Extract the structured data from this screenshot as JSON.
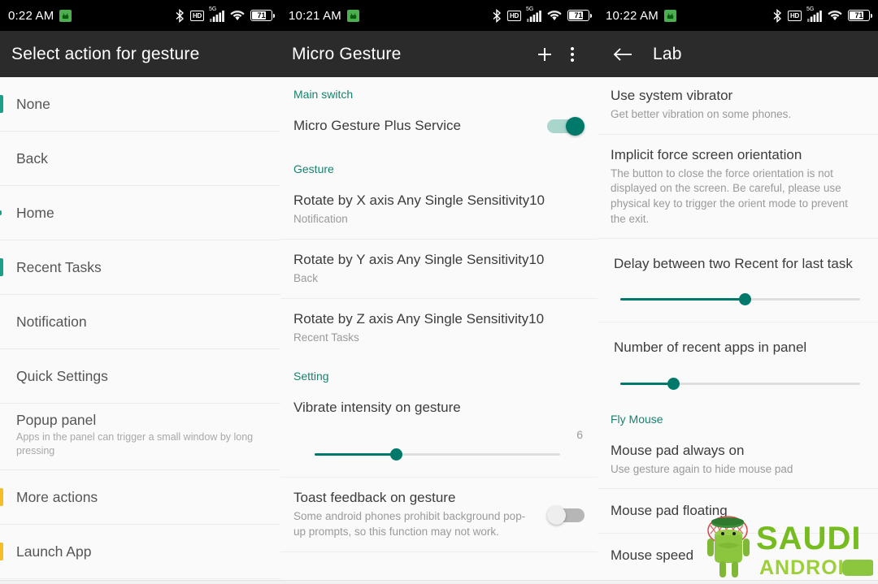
{
  "panels": [
    {
      "statusbar": {
        "time": "0:22 AM",
        "battery_percent": "71",
        "network": "5G",
        "hd": "HD"
      },
      "toolbar": {
        "title": "Select action for gesture"
      },
      "items": [
        {
          "label": "None",
          "sub": "",
          "marker": "teal"
        },
        {
          "label": "Back",
          "sub": "",
          "marker": "none"
        },
        {
          "label": "Home",
          "sub": "",
          "marker": "teal-sm"
        },
        {
          "label": "Recent Tasks",
          "sub": "",
          "marker": "teal"
        },
        {
          "label": "Notification",
          "sub": "",
          "marker": "none"
        },
        {
          "label": "Quick Settings",
          "sub": "",
          "marker": "teal-dots"
        },
        {
          "label": "Popup panel",
          "sub": "Apps in the panel can trigger a small window by long pressing",
          "marker": "none"
        },
        {
          "label": "More actions",
          "sub": "",
          "marker": "amber"
        },
        {
          "label": "Launch App",
          "sub": "",
          "marker": "amber"
        }
      ]
    },
    {
      "statusbar": {
        "time": "10:21 AM",
        "battery_percent": "71",
        "network": "5G",
        "hd": "HD"
      },
      "toolbar": {
        "title": "Micro Gesture",
        "add_label": "+",
        "overflow_label": "More options"
      },
      "sections": [
        {
          "header": "Main switch"
        },
        {
          "header": "Gesture"
        },
        {
          "header": "Setting"
        }
      ],
      "main_switch": {
        "label": "Micro Gesture Plus Service",
        "state": "on"
      },
      "gestures": [
        {
          "title": "Rotate by X axis Any Single Sensitivity10",
          "sub": "Notification"
        },
        {
          "title": "Rotate by Y axis Any Single Sensitivity10",
          "sub": "Back"
        },
        {
          "title": "Rotate by Z axis Any Single Sensitivity10",
          "sub": "Recent Tasks"
        }
      ],
      "vibrate": {
        "title": "Vibrate intensity on gesture",
        "value": "6",
        "percent": 33
      },
      "toast": {
        "title": "Toast feedback on gesture",
        "sub": "Some android phones prohibit background pop-up prompts, so this function may not work.",
        "state": "off"
      }
    },
    {
      "statusbar": {
        "time": "10:22 AM",
        "battery_percent": "71",
        "network": "5G",
        "hd": "HD"
      },
      "toolbar": {
        "title": "Lab",
        "back_label": "Back"
      },
      "items": [
        {
          "title": "Use system vibrator",
          "sub": "Get better vibration on some phones."
        },
        {
          "title": "Implicit force screen orientation",
          "sub": "The button to close the force orientation is not displayed on the screen. Be careful, please use physical key to trigger the orient mode to prevent the exit."
        }
      ],
      "delay_slider": {
        "title": "Delay between two Recent for last task",
        "percent": 52
      },
      "recent_apps_slider": {
        "title": "Number of recent apps in panel",
        "percent": 22
      },
      "fly_mouse_header": "Fly Mouse",
      "fly_items": [
        {
          "title": "Mouse pad always on",
          "sub": "Use gesture again to hide mouse pad"
        },
        {
          "title": "Mouse pad floating",
          "sub": ""
        },
        {
          "title": "Mouse speed",
          "sub": ""
        }
      ]
    }
  ],
  "watermark": {
    "line1": "SAUDI",
    "line2": "ANDROID"
  },
  "colors": {
    "accent_teal": "#00796b",
    "section_header": "#17826f",
    "amber": "#f5bd26",
    "toolbar_bg": "#2b2b2b",
    "statusbar_bg": "#000000",
    "panel_bg": "#fafafa",
    "watermark_green": "#76bc21",
    "watermark_light_green": "#a8d14a"
  }
}
